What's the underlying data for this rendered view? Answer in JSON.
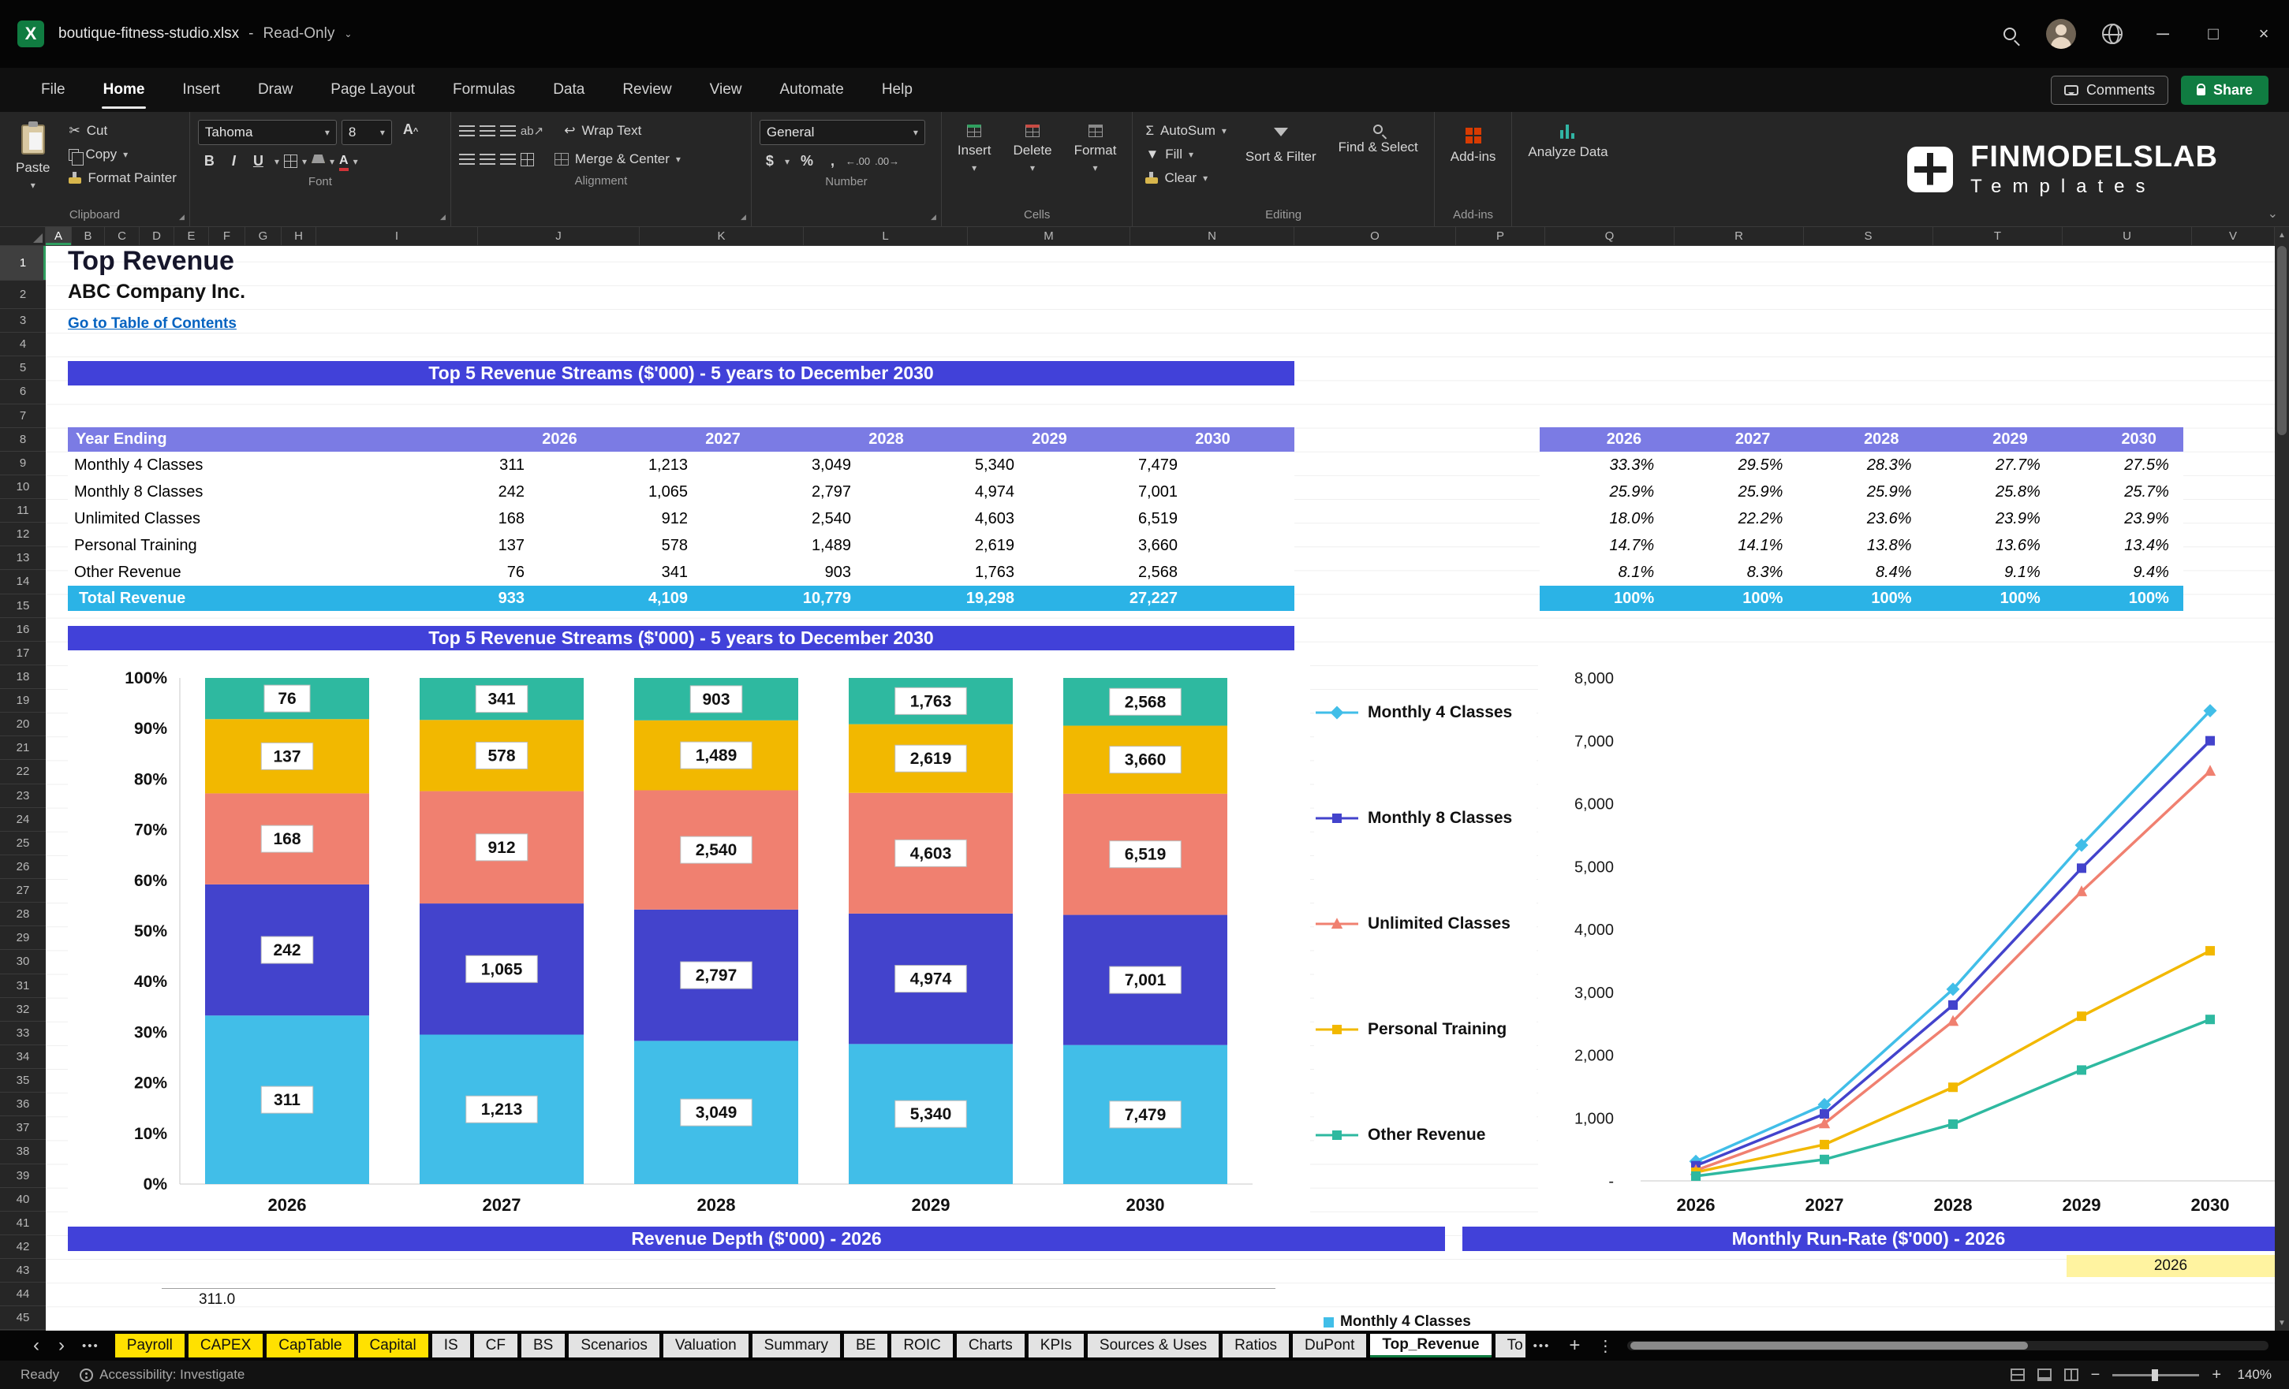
{
  "theme": {
    "banner_blue": "#4141D9",
    "header_violet": "#7B7BE4",
    "total_cyan": "#2BB3E6",
    "link_blue": "#0563C1",
    "tab_yellow": "#FFE100",
    "share_green": "#107C41"
  },
  "icons": {
    "caret": "▾",
    "chevron_up": "⌃",
    "chevron_down": "⌄",
    "scissors": "✂",
    "sigma": "Σ",
    "dollar": "$",
    "percent": "%",
    "comma": ",",
    "dec_left": "←.00",
    "dec_right": ".00→",
    "wrap": "↩",
    "orient": "ab↗",
    "nav_left": "‹",
    "nav_right": "›",
    "ellipsis": "•••",
    "plus": "+",
    "kebab": "⋮",
    "minus": "−",
    "minimize": "─",
    "maximize": "□",
    "close": "×",
    "up": "▲",
    "down": "▼",
    "launcher": "◢",
    "app_letter": "X"
  },
  "titlebar": {
    "filename": "boutique-fitness-studio.xlsx",
    "separator": "-",
    "mode": "Read-Only"
  },
  "menubar": {
    "items": [
      "File",
      "Home",
      "Insert",
      "Draw",
      "Page Layout",
      "Formulas",
      "Data",
      "Review",
      "View",
      "Automate",
      "Help"
    ],
    "active_item": "Home",
    "comments_label": "Comments",
    "share_label": "Share"
  },
  "ribbon": {
    "clipboard": {
      "paste": "Paste",
      "cut": "Cut",
      "copy": "Copy",
      "format_painter": "Format Painter",
      "group_label": "Clipboard"
    },
    "font": {
      "font_name": "Tahoma",
      "font_size": "8",
      "bold": "B",
      "italic": "I",
      "underline": "U",
      "group_label": "Font"
    },
    "alignment": {
      "wrap_text": "Wrap Text",
      "merge_center": "Merge & Center",
      "group_label": "Alignment"
    },
    "number": {
      "format": "General",
      "group_label": "Number"
    },
    "cells": {
      "insert": "Insert",
      "delete": "Delete",
      "format": "Format",
      "group_label": "Cells"
    },
    "editing": {
      "autosum": "AutoSum",
      "fill": "Fill",
      "clear": "Clear",
      "sort_filter": "Sort & Filter",
      "find_select": "Find & Select",
      "group_label": "Editing"
    },
    "addins_label": "Add-ins",
    "addins_group_label": "Add-ins",
    "analyze_label": "Analyze Data",
    "logo_line1": "FINMODELSLAB",
    "logo_line2": "Templates"
  },
  "grid": {
    "columns": [
      "A",
      "B",
      "C",
      "D",
      "E",
      "F",
      "G",
      "H",
      "I",
      "J",
      "K",
      "L",
      "M",
      "N",
      "O",
      "P",
      "Q",
      "R",
      "S",
      "T",
      "U",
      "V"
    ],
    "row_count": 45,
    "selected_column": "A",
    "selected_row": "1"
  },
  "sheet": {
    "title": "Top Revenue",
    "company": "ABC Company Inc.",
    "toc_link": "Go to Table of Contents",
    "banner_top": "Top 5 Revenue Streams ($'000) - 5 years to December 2030",
    "banner_charts": "Top 5 Revenue Streams ($'000) - 5 years to December 2030",
    "banner_depth": "Revenue Depth ($'000) - 2026",
    "banner_runrate": "Monthly Run-Rate ($'000) - 2026",
    "table": {
      "header_label": "Year Ending",
      "years": [
        "2026",
        "2027",
        "2028",
        "2029",
        "2030"
      ],
      "rows": [
        {
          "label": "Monthly 4 Classes",
          "values": [
            "311",
            "1,213",
            "3,049",
            "5,340",
            "7,479"
          ]
        },
        {
          "label": "Monthly 8 Classes",
          "values": [
            "242",
            "1,065",
            "2,797",
            "4,974",
            "7,001"
          ]
        },
        {
          "label": "Unlimited Classes",
          "values": [
            "168",
            "912",
            "2,540",
            "4,603",
            "6,519"
          ]
        },
        {
          "label": "Personal Training",
          "values": [
            "137",
            "578",
            "1,489",
            "2,619",
            "3,660"
          ]
        },
        {
          "label": "Other Revenue",
          "values": [
            "76",
            "341",
            "903",
            "1,763",
            "2,568"
          ]
        }
      ],
      "total_label": "Total Revenue",
      "total_values": [
        "933",
        "4,109",
        "10,779",
        "19,298",
        "27,227"
      ]
    },
    "pct_table": {
      "years": [
        "2026",
        "2027",
        "2028",
        "2029",
        "2030"
      ],
      "rows": [
        [
          "33.3%",
          "29.5%",
          "28.3%",
          "27.7%",
          "27.5%"
        ],
        [
          "25.9%",
          "25.9%",
          "25.9%",
          "25.8%",
          "25.7%"
        ],
        [
          "18.0%",
          "22.2%",
          "23.6%",
          "23.9%",
          "23.9%"
        ],
        [
          "14.7%",
          "14.1%",
          "13.8%",
          "13.6%",
          "13.4%"
        ],
        [
          "8.1%",
          "8.3%",
          "8.4%",
          "9.1%",
          "9.4%"
        ]
      ],
      "total_values": [
        "100%",
        "100%",
        "100%",
        "100%",
        "100%"
      ]
    },
    "runrate_year": "2026",
    "depth_partial_value": "311.0",
    "depth_partial_legend": "Monthly 4 Classes"
  },
  "chart_data": [
    {
      "type": "bar",
      "subtype": "stacked-100pct",
      "title": "Top 5 Revenue Streams ($'000) - 5 years to December 2030",
      "categories": [
        "2026",
        "2027",
        "2028",
        "2029",
        "2030"
      ],
      "series": [
        {
          "name": "Monthly 4 Classes",
          "color": "#41BEE8",
          "marker": "diamond",
          "values": [
            311,
            1213,
            3049,
            5340,
            7479
          ]
        },
        {
          "name": "Monthly 8 Classes",
          "color": "#4343CC",
          "marker": "square",
          "values": [
            242,
            1065,
            2797,
            4974,
            7001
          ]
        },
        {
          "name": "Unlimited Classes",
          "color": "#F08070",
          "marker": "triangle",
          "values": [
            168,
            912,
            2540,
            4603,
            6519
          ]
        },
        {
          "name": "Personal Training",
          "color": "#F2B800",
          "marker": "square",
          "values": [
            137,
            578,
            1489,
            2619,
            3660
          ]
        },
        {
          "name": "Other Revenue",
          "color": "#2EB9A0",
          "marker": "square",
          "values": [
            76,
            341,
            903,
            1763,
            2568
          ]
        }
      ],
      "y_ticks": [
        "100%",
        "90%",
        "80%",
        "70%",
        "60%",
        "50%",
        "40%",
        "30%",
        "20%",
        "10%",
        "0%"
      ],
      "data_labels": true,
      "legend_position": "between-charts",
      "grid": false
    },
    {
      "type": "line",
      "categories": [
        "2026",
        "2027",
        "2028",
        "2029",
        "2030"
      ],
      "series": [
        {
          "name": "Monthly 4 Classes",
          "color": "#41BEE8",
          "marker": "diamond",
          "values": [
            311,
            1213,
            3049,
            5340,
            7479
          ]
        },
        {
          "name": "Monthly 8 Classes",
          "color": "#4343CC",
          "marker": "square",
          "values": [
            242,
            1065,
            2797,
            4974,
            7001
          ]
        },
        {
          "name": "Unlimited Classes",
          "color": "#F08070",
          "marker": "triangle",
          "values": [
            168,
            912,
            2540,
            4603,
            6519
          ]
        },
        {
          "name": "Personal Training",
          "color": "#F2B800",
          "marker": "square",
          "values": [
            137,
            578,
            1489,
            2619,
            3660
          ]
        },
        {
          "name": "Other Revenue",
          "color": "#2EB9A0",
          "marker": "square",
          "values": [
            76,
            341,
            903,
            1763,
            2568
          ]
        }
      ],
      "ylim": [
        0,
        8000
      ],
      "y_ticks": [
        "8,000",
        "7,000",
        "6,000",
        "5,000",
        "4,000",
        "3,000",
        "2,000",
        "1,000",
        "-"
      ],
      "grid": false
    }
  ],
  "sheet_tabs": {
    "tabs": [
      {
        "label": "Payroll",
        "style": "yellow"
      },
      {
        "label": "CAPEX",
        "style": "yellow"
      },
      {
        "label": "CapTable",
        "style": "yellow"
      },
      {
        "label": "Capital",
        "style": "yellow"
      },
      {
        "label": "IS",
        "style": "light"
      },
      {
        "label": "CF",
        "style": "light"
      },
      {
        "label": "BS",
        "style": "light"
      },
      {
        "label": "Scenarios",
        "style": "light"
      },
      {
        "label": "Valuation",
        "style": "light"
      },
      {
        "label": "Summary",
        "style": "light"
      },
      {
        "label": "BE",
        "style": "light"
      },
      {
        "label": "ROIC",
        "style": "light"
      },
      {
        "label": "Charts",
        "style": "light"
      },
      {
        "label": "KPIs",
        "style": "light"
      },
      {
        "label": "Sources & Uses",
        "style": "light"
      },
      {
        "label": "Ratios",
        "style": "light"
      },
      {
        "label": "DuPont",
        "style": "light"
      },
      {
        "label": "Top_Revenue",
        "style": "active"
      },
      {
        "label": "To",
        "style": "light",
        "clipped": true
      }
    ]
  },
  "statusbar": {
    "ready": "Ready",
    "accessibility": "Accessibility: Investigate",
    "zoom_level": "140%"
  }
}
